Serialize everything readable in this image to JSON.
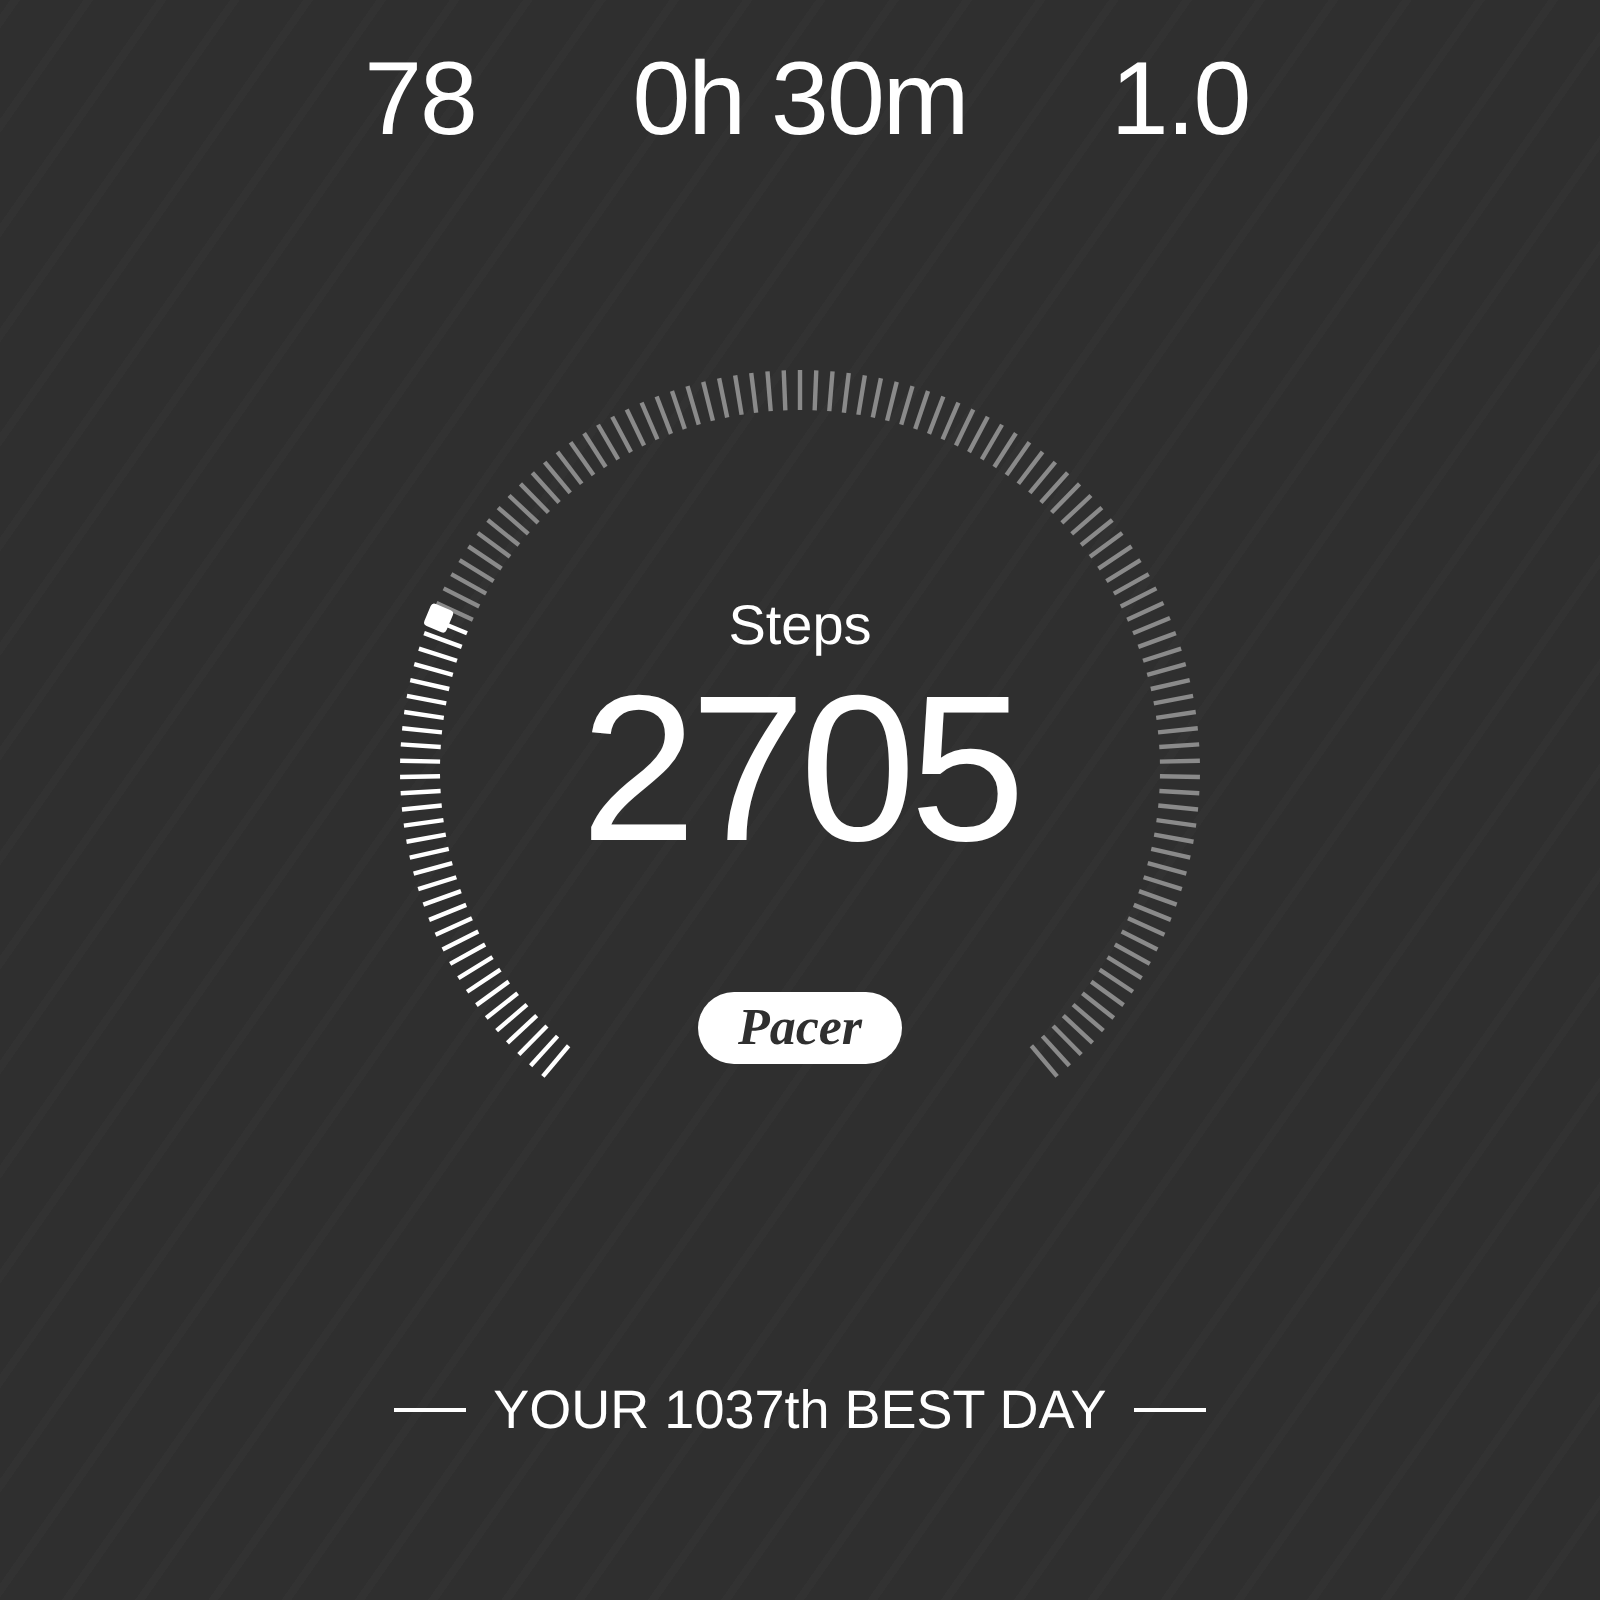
{
  "stats": [
    {
      "value": "78"
    },
    {
      "value": "0h 30m"
    },
    {
      "value": "1.0"
    }
  ],
  "steps": {
    "label": "Steps",
    "value": "2705"
  },
  "logo": "Pacer",
  "rank_banner": "YOUR 1037th BEST DAY"
}
